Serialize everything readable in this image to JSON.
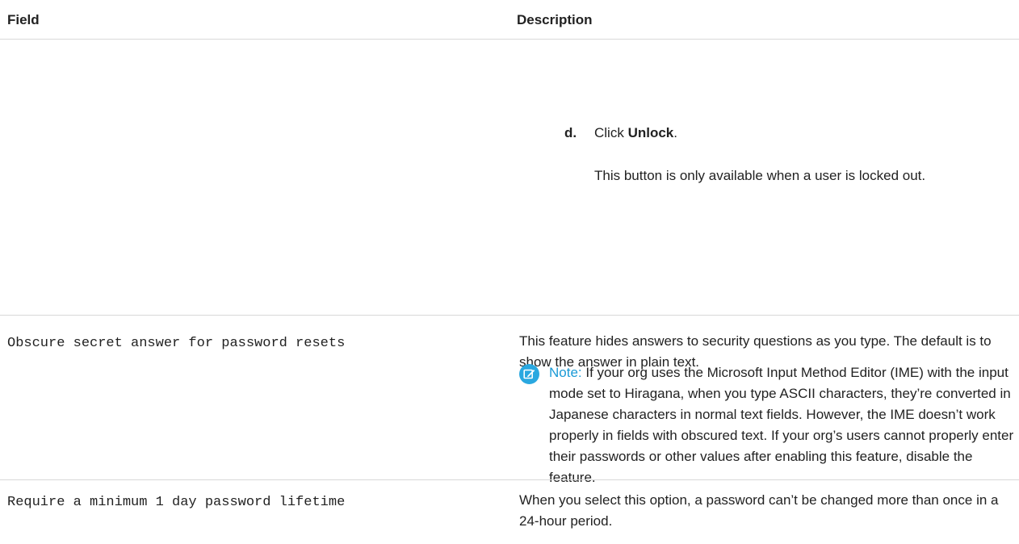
{
  "table": {
    "headers": {
      "field": "Field",
      "description": "Description"
    },
    "step": {
      "number": "d.",
      "prefix": "Click ",
      "action": "Unlock",
      "suffix": ".",
      "detail": "This button is only available when a user is locked out."
    },
    "rows": [
      {
        "field": "Obscure secret answer for password resets",
        "description": "This feature hides answers to security questions as you type. The default is to show the answer in plain text.",
        "note": {
          "label": "Note:",
          "text": "If your org uses the Microsoft Input Method Editor (IME) with the input mode set to Hiragana, when you type ASCII characters, they’re converted in Japanese characters in normal text fields. However, the IME doesn’t work properly in fields with obscured text. If your org’s users cannot properly enter their passwords or other values after enabling this feature, disable the feature."
        }
      },
      {
        "field": "Require a minimum 1 day password lifetime",
        "description": "When you select this option, a password can’t be changed more than once in a 24-hour period."
      }
    ]
  },
  "icons": {
    "note": "note-edit-icon"
  },
  "colors": {
    "note_accent": "#2aa8e0",
    "note_label": "#1a9ad6",
    "divider": "#d8d8d8"
  }
}
